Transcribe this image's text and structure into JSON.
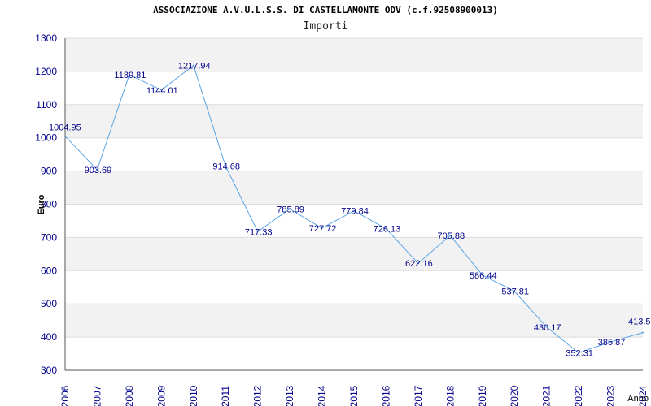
{
  "chart_data": {
    "type": "line",
    "title": "ASSOCIAZIONE A.V.U.L.S.S. DI CASTELLAMONTE ODV (c.f.92508900013)",
    "subtitle": "Importi",
    "xlabel": "Anno",
    "ylabel": "Euro",
    "ylim": [
      300,
      1300
    ],
    "y_ticks": [
      300,
      400,
      500,
      600,
      700,
      800,
      900,
      1000,
      1100,
      1200,
      1300
    ],
    "grid": true,
    "x": [
      "2006",
      "2007",
      "2008",
      "2009",
      "2010",
      "2011",
      "2012",
      "2013",
      "2014",
      "2015",
      "2016",
      "2017",
      "2018",
      "2019",
      "2020",
      "2021",
      "2022",
      "2023",
      "2024"
    ],
    "series": [
      {
        "values": [
          1004.95,
          903.69,
          1189.81,
          1144.01,
          1217.94,
          914.68,
          717.33,
          785.89,
          727.72,
          779.84,
          726.13,
          622.16,
          705.88,
          586.44,
          537.81,
          430.17,
          352.31,
          385.87,
          413.5
        ],
        "labels": [
          "1004.95",
          "903.69",
          "1189.81",
          "1144.01",
          "1217.94",
          "914.68",
          "717.33",
          "785.89",
          "727.72",
          "779.84",
          "726.13",
          "622.16",
          "705.88",
          "586.44",
          "537.81",
          "430.17",
          "352.31",
          "385.87",
          "413.5"
        ]
      }
    ],
    "colors": {
      "line": "#5aa5e6",
      "labels": "#00008b",
      "band": "#f2f2f2",
      "gridline": "#dcdcdc",
      "axis": "#555555"
    }
  }
}
